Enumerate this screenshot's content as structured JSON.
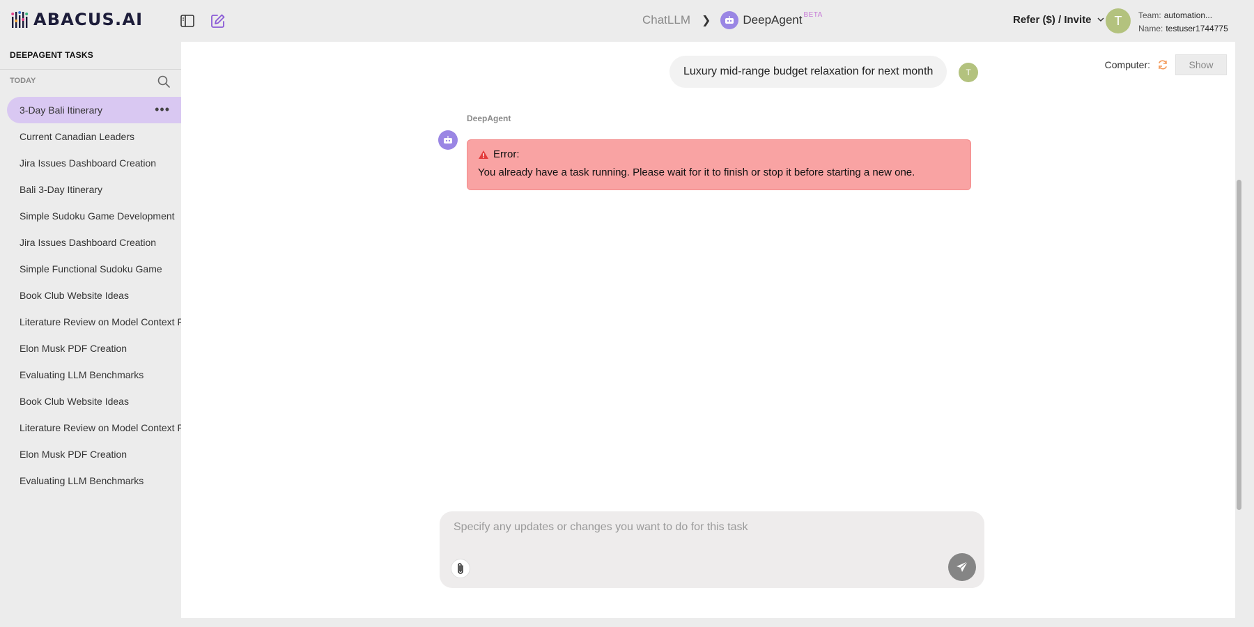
{
  "brand": {
    "name": "ABACUS.AI"
  },
  "header": {
    "breadcrumb": {
      "root": "ChatLLM",
      "current": "DeepAgent",
      "badge": "BETA"
    },
    "refer_label": "Refer ($) / Invite",
    "user": {
      "initial": "T",
      "team_label": "Team:",
      "team_value": "automation...",
      "name_label": "Name:",
      "name_value": "testuser1744775"
    }
  },
  "sidebar": {
    "title": "DEEPAGENT TASKS",
    "section": "TODAY",
    "items": [
      {
        "label": "3-Day Bali Itinerary",
        "active": true
      },
      {
        "label": "Current Canadian Leaders"
      },
      {
        "label": "Jira Issues Dashboard Creation"
      },
      {
        "label": "Bali 3-Day Itinerary"
      },
      {
        "label": "Simple Sudoku Game Development"
      },
      {
        "label": "Jira Issues Dashboard Creation"
      },
      {
        "label": "Simple Functional Sudoku Game"
      },
      {
        "label": "Book Club Website Ideas"
      },
      {
        "label": "Literature Review on Model Context P"
      },
      {
        "label": "Elon Musk PDF Creation"
      },
      {
        "label": "Evaluating LLM Benchmarks"
      },
      {
        "label": "Book Club Website Ideas"
      },
      {
        "label": "Literature Review on Model Context P"
      },
      {
        "label": "Elon Musk PDF Creation"
      },
      {
        "label": "Evaluating LLM Benchmarks"
      }
    ]
  },
  "computer": {
    "label": "Computer:",
    "show_label": "Show"
  },
  "chat": {
    "user_message": "Luxury mid-range budget relaxation for next month",
    "user_initial": "T",
    "agent_name": "DeepAgent",
    "error_title": "Error:",
    "error_message": "You already have a task running. Please wait for it to finish or stop it before starting a new one."
  },
  "input": {
    "placeholder": "Specify any updates or changes you want to do for this task"
  },
  "colors": {
    "accent": "#9a86e4",
    "active_item": "#d9c8f2",
    "error_bg": "#f9a3a3",
    "avatar": "#b3c27e"
  }
}
